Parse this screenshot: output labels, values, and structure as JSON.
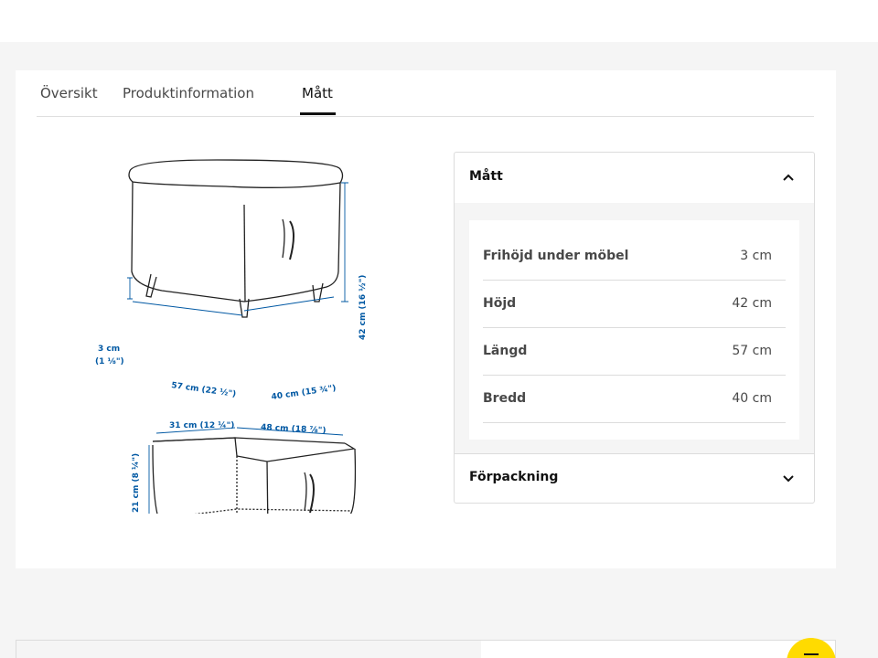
{
  "tabs": {
    "overview": "Översikt",
    "product_info": "Produktinformation",
    "measurements": "Mått"
  },
  "drawing": {
    "top_view": {
      "seat_height": "3 cm",
      "seat_height_in": "(1 ⅛\")",
      "length": "57 cm (22 ½\")",
      "width": "40 cm (15 ¾\")",
      "height": "42 cm (16 ½\")"
    },
    "inner_view": {
      "inner_width": "31 cm (12 ¼\")",
      "inner_length": "48 cm (18 ⅞\")",
      "inner_height": "21 cm (8 ¼\")"
    }
  },
  "accordion": {
    "measurements_title": "Mått",
    "packaging_title": "Förpackning",
    "rows": [
      {
        "label": "Frihöjd under möbel",
        "value": "3 cm"
      },
      {
        "label": "Höjd",
        "value": "42 cm"
      },
      {
        "label": "Längd",
        "value": "57 cm"
      },
      {
        "label": "Bredd",
        "value": "40 cm"
      }
    ]
  },
  "colors": {
    "accent_dimension": "#0058a3",
    "fab": "#ffdb00"
  }
}
